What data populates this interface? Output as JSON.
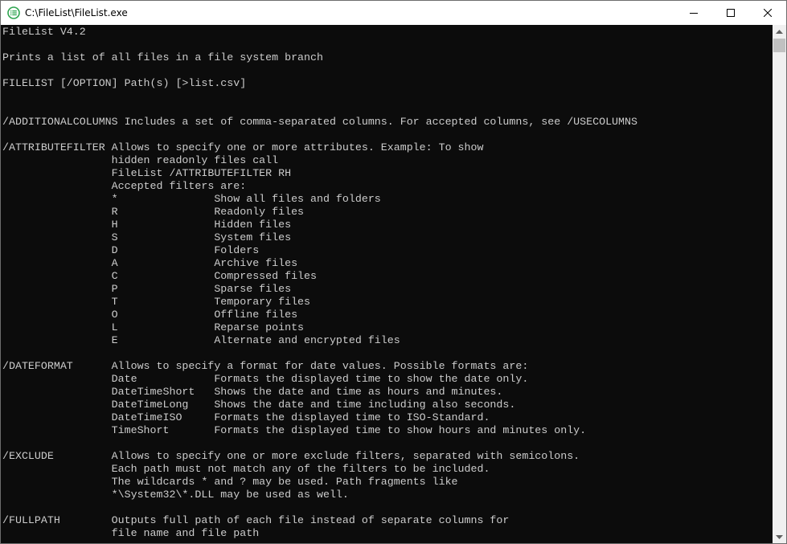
{
  "window": {
    "title": "C:\\FileList\\FileList.exe",
    "icon": "filelist-app-icon",
    "controls": [
      "minimize-icon",
      "maximize-icon",
      "close-icon"
    ]
  },
  "console": {
    "lines": [
      "FileList V4.2",
      "",
      "Prints a list of all files in a file system branch",
      "",
      "FILELIST [/OPTION] Path(s) [>list.csv]",
      "",
      "",
      "/ADDITIONALCOLUMNS Includes a set of comma-separated columns. For accepted columns, see /USECOLUMNS",
      "",
      "/ATTRIBUTEFILTER Allows to specify one or more attributes. Example: To show",
      "                 hidden readonly files call",
      "                 FileList /ATTRIBUTEFILTER RH",
      "                 Accepted filters are:",
      "                 *               Show all files and folders",
      "                 R               Readonly files",
      "                 H               Hidden files",
      "                 S               System files",
      "                 D               Folders",
      "                 A               Archive files",
      "                 C               Compressed files",
      "                 P               Sparse files",
      "                 T               Temporary files",
      "                 O               Offline files",
      "                 L               Reparse points",
      "                 E               Alternate and encrypted files",
      "",
      "/DATEFORMAT      Allows to specify a format for date values. Possible formats are:",
      "                 Date            Formats the displayed time to show the date only.",
      "                 DateTimeShort   Shows the date and time as hours and minutes.",
      "                 DateTimeLong    Shows the date and time including also seconds.",
      "                 DateTimeISO     Formats the displayed time to ISO-Standard.",
      "                 TimeShort       Formats the displayed time to show hours and minutes only.",
      "",
      "/EXCLUDE         Allows to specify one or more exclude filters, separated with semicolons.",
      "                 Each path must not match any of the filters to be included.",
      "                 The wildcards * and ? may be used. Path fragments like",
      "                 *\\System32\\*.DLL may be used as well.",
      "",
      "/FULLPATH        Outputs full path of each file instead of separate columns for",
      "                 file name and file path"
    ]
  },
  "scrollbar": {
    "up": "scroll-up-arrow-icon",
    "down": "scroll-down-arrow-icon"
  }
}
